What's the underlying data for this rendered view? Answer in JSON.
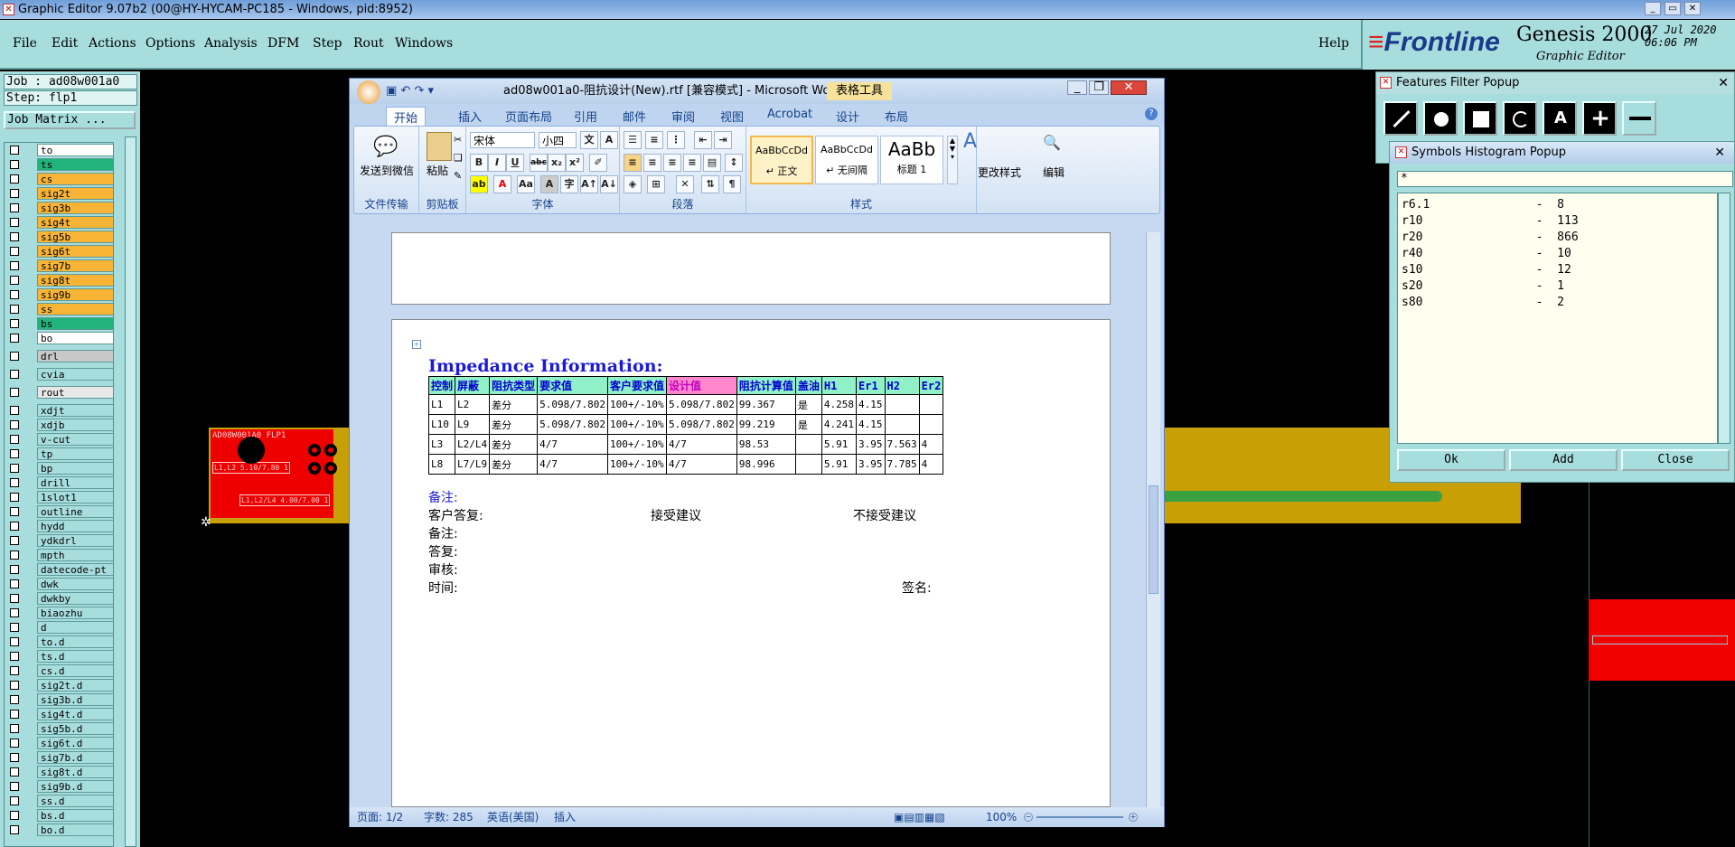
{
  "titlebar": {
    "title": "Graphic Editor 9.07b2 (00@HY-HYCAM-PC185 - Windows, pid:8952)"
  },
  "menu": [
    "File",
    "Edit",
    "Actions",
    "Options",
    "Analysis",
    "DFM",
    "Step",
    "Rout",
    "Windows"
  ],
  "help_label": "Help",
  "brand": {
    "name1": "Frontline",
    "product": "Genesis 2000",
    "sub": "Graphic Editor",
    "date": "27 Jul 2020",
    "time": "06:06 PM"
  },
  "leftpanel": {
    "job": "Job : ad08w001a0",
    "step": "Step: flp1",
    "matrix": "Job Matrix ..."
  },
  "layers": [
    {
      "name": "to",
      "color": "#ffffff"
    },
    {
      "name": "ts",
      "color": "#21b37a"
    },
    {
      "name": "cs",
      "color": "#f7b436"
    },
    {
      "name": "sig2t",
      "color": "#f7b436"
    },
    {
      "name": "sig3b",
      "color": "#f7b436"
    },
    {
      "name": "sig4t",
      "color": "#f7b436"
    },
    {
      "name": "sig5b",
      "color": "#f7b436"
    },
    {
      "name": "sig6t",
      "color": "#f7b436"
    },
    {
      "name": "sig7b",
      "color": "#f7b436"
    },
    {
      "name": "sig8t",
      "color": "#f7b436"
    },
    {
      "name": "sig9b",
      "color": "#f7b436"
    },
    {
      "name": "ss",
      "color": "#f7b436"
    },
    {
      "name": "bs",
      "color": "#21b37a"
    },
    {
      "name": "bo",
      "color": "#ffffff"
    },
    {
      "name": "drl",
      "color": "#c8c8c8"
    },
    {
      "name": "cvia",
      "color": "#a8dddd"
    },
    {
      "name": "rout",
      "color": "#e8e8e8"
    },
    {
      "name": "xdjt",
      "color": "#a8dddd"
    },
    {
      "name": "xdjb",
      "color": "#a8dddd"
    },
    {
      "name": "v-cut",
      "color": "#a8dddd"
    },
    {
      "name": "tp",
      "color": "#a8dddd"
    },
    {
      "name": "bp",
      "color": "#a8dddd"
    },
    {
      "name": "drill",
      "color": "#a8dddd"
    },
    {
      "name": "1slot1",
      "color": "#a8dddd"
    },
    {
      "name": "outline",
      "color": "#a8dddd"
    },
    {
      "name": "hydd",
      "color": "#a8dddd"
    },
    {
      "name": "ydkdrl",
      "color": "#a8dddd"
    },
    {
      "name": "mpth",
      "color": "#a8dddd"
    },
    {
      "name": "datecode-pt",
      "color": "#a8dddd"
    },
    {
      "name": "dwk",
      "color": "#a8dddd"
    },
    {
      "name": "dwkby",
      "color": "#a8dddd"
    },
    {
      "name": "biaozhu",
      "color": "#a8dddd"
    },
    {
      "name": "d",
      "color": "#a8dddd"
    },
    {
      "name": "to.d",
      "color": "#a8dddd"
    },
    {
      "name": "ts.d",
      "color": "#a8dddd"
    },
    {
      "name": "cs.d",
      "color": "#a8dddd"
    },
    {
      "name": "sig2t.d",
      "color": "#a8dddd"
    },
    {
      "name": "sig3b.d",
      "color": "#a8dddd"
    },
    {
      "name": "sig4t.d",
      "color": "#a8dddd"
    },
    {
      "name": "sig5b.d",
      "color": "#a8dddd"
    },
    {
      "name": "sig6t.d",
      "color": "#a8dddd"
    },
    {
      "name": "sig7b.d",
      "color": "#a8dddd"
    },
    {
      "name": "sig8t.d",
      "color": "#a8dddd"
    },
    {
      "name": "sig9b.d",
      "color": "#a8dddd"
    },
    {
      "name": "ss.d",
      "color": "#a8dddd"
    },
    {
      "name": "bs.d",
      "color": "#a8dddd"
    },
    {
      "name": "bo.d",
      "color": "#a8dddd"
    }
  ],
  "board_labels": [
    "AD08W001A0 FLP1",
    "L1,L2 5.10/7.80 1",
    "L1,L2/L4 4.00/7.00 1"
  ],
  "word": {
    "title": "ad08w001a0-阻抗设计(New).rtf [兼容模式] - Microsoft Wo...",
    "context_tab": "表格工具",
    "tabs": [
      "开始",
      "插入",
      "页面布局",
      "引用",
      "邮件",
      "审阅",
      "视图",
      "Acrobat",
      "设计",
      "布局"
    ],
    "groups": {
      "send": "发送到微信",
      "send_group": "文件传输",
      "paste": "粘贴",
      "clipboard": "剪贴板",
      "font_group": "字体",
      "para_group": "段落",
      "styles_group": "样式",
      "change_styles": "更改样式",
      "edit": "编辑"
    },
    "font_name": "宋体",
    "font_size": "小四",
    "styles": [
      {
        "sample": "AaBbCcDd",
        "name": "↵ 正文"
      },
      {
        "sample": "AaBbCcDd",
        "name": "↵ 无间隔"
      },
      {
        "sample": "AaBb",
        "name": "标题 1"
      }
    ],
    "doc_heading": "Impedance Information:",
    "table_headers": [
      "控制",
      "屏蔽",
      "阻抗类型",
      "要求值",
      "客户要求值",
      "设计值",
      "阻抗计算值",
      "盖油",
      "H1",
      "Er1",
      "H2",
      "Er2"
    ],
    "table_rows": [
      [
        "L1",
        "L2",
        "差分",
        "5.098/7.802",
        "100+/-10%",
        "5.098/7.802",
        "99.367",
        "是",
        "4.258",
        "4.15",
        "",
        ""
      ],
      [
        "L10",
        "L9",
        "差分",
        "5.098/7.802",
        "100+/-10%",
        "5.098/7.802",
        "99.219",
        "是",
        "4.241",
        "4.15",
        "",
        ""
      ],
      [
        "L3",
        "L2/L4",
        "差分",
        "4/7",
        "100+/-10%",
        "4/7",
        "98.53",
        "",
        "5.91",
        "3.95",
        "7.563",
        "4"
      ],
      [
        "L8",
        "L7/L9",
        "差分",
        "4/7",
        "100+/-10%",
        "4/7",
        "98.996",
        "",
        "5.91",
        "3.95",
        "7.785",
        "4"
      ]
    ],
    "notes": {
      "remark_blue": "备注:",
      "reply": "客户答复:",
      "accept": "接受建议",
      "reject": "不接受建议",
      "remark": "备注:",
      "answer": "答复:",
      "audit": "审核:",
      "time": "时间:",
      "sign": "签名:"
    },
    "status": {
      "page": "页面: 1/2",
      "words": "字数: 285",
      "lang": "英语(美国)",
      "mode": "插入",
      "zoom": "100%"
    }
  },
  "features_filter": {
    "title": "Features Filter Popup"
  },
  "symbols_histogram": {
    "title": "Symbols Histogram Popup",
    "filter": "*",
    "items": [
      "r6.1               -  8",
      "r10                -  113",
      "r20                -  866",
      "r40                -  10",
      "s10                -  12",
      "s20                -  1",
      "s80                -  2"
    ],
    "ok": "Ok",
    "add": "Add",
    "close": "Close"
  }
}
